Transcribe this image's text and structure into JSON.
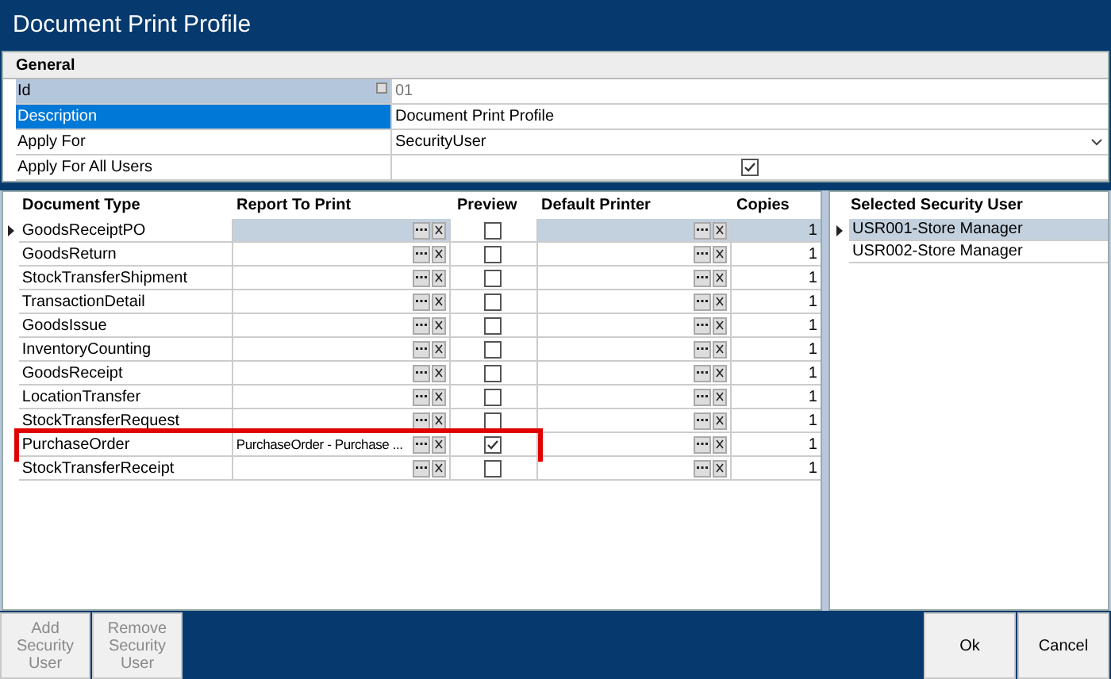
{
  "window": {
    "title": "Document Print Profile"
  },
  "general": {
    "title": "General",
    "fields": [
      {
        "kind": "readonly",
        "label": "Id",
        "value": "01",
        "selected": false
      },
      {
        "kind": "text",
        "label": "Description",
        "value": "Document Print Profile",
        "selected": true
      },
      {
        "kind": "dropdown",
        "label": "Apply For",
        "value": "SecurityUser",
        "selected": false
      },
      {
        "kind": "checkbox",
        "label": "Apply For All Users",
        "checked": true,
        "selected": false
      }
    ]
  },
  "grid": {
    "columns": [
      "Document Type",
      "Report To Print",
      "Preview",
      "Default Printer",
      "Copies"
    ],
    "rows": [
      {
        "document_type": "GoodsReceiptPO",
        "report": "",
        "preview": false,
        "copies": "1",
        "selected": true,
        "highlighted": false
      },
      {
        "document_type": "GoodsReturn",
        "report": "",
        "preview": false,
        "copies": "1",
        "selected": false,
        "highlighted": false
      },
      {
        "document_type": "StockTransferShipment",
        "report": "",
        "preview": false,
        "copies": "1",
        "selected": false,
        "highlighted": false
      },
      {
        "document_type": "TransactionDetail",
        "report": "",
        "preview": false,
        "copies": "1",
        "selected": false,
        "highlighted": false
      },
      {
        "document_type": "GoodsIssue",
        "report": "",
        "preview": false,
        "copies": "1",
        "selected": false,
        "highlighted": false
      },
      {
        "document_type": "InventoryCounting",
        "report": "",
        "preview": false,
        "copies": "1",
        "selected": false,
        "highlighted": false
      },
      {
        "document_type": "GoodsReceipt",
        "report": "",
        "preview": false,
        "copies": "1",
        "selected": false,
        "highlighted": false
      },
      {
        "document_type": "LocationTransfer",
        "report": "",
        "preview": false,
        "copies": "1",
        "selected": false,
        "highlighted": false
      },
      {
        "document_type": "StockTransferRequest",
        "report": "",
        "preview": false,
        "copies": "1",
        "selected": false,
        "highlighted": false
      },
      {
        "document_type": "PurchaseOrder",
        "report": "PurchaseOrder - Purchase ...",
        "preview": true,
        "copies": "1",
        "selected": false,
        "highlighted": true
      },
      {
        "document_type": "StockTransferReceipt",
        "report": "",
        "preview": false,
        "copies": "1",
        "selected": false,
        "highlighted": false
      }
    ]
  },
  "users": {
    "title": "Selected Security User",
    "items": [
      {
        "label": "USR001-Store Manager",
        "selected": true
      },
      {
        "label": "USR002-Store Manager",
        "selected": false
      }
    ]
  },
  "buttons": [
    {
      "label": "Add Security User",
      "disabled": true
    },
    {
      "label": "Remove Security User",
      "disabled": true
    },
    {
      "label": "Ok",
      "disabled": false
    },
    {
      "label": "Cancel",
      "disabled": false
    }
  ]
}
